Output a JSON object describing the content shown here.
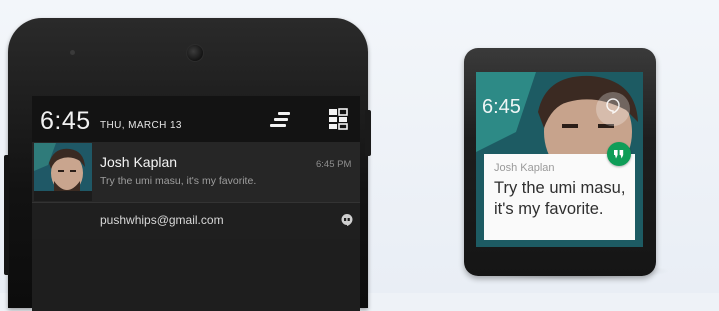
{
  "phone": {
    "status_bar": {
      "time": "6:45",
      "date": "THU, MARCH 13",
      "notifications_icon": "notification-shade-icon",
      "quick_settings_icon": "quick-settings-icon"
    },
    "notification": {
      "sender": "Josh Kaplan",
      "message": "Try the umi masu, it's my favorite.",
      "time": "6:45 PM",
      "account": "pushwhips@gmail.com",
      "app_icon": "hangouts-icon"
    }
  },
  "watch": {
    "time": "6:45",
    "card": {
      "sender": "Josh Kaplan",
      "message": "Try the umi masu, it's my favorite."
    },
    "app_icon": "hangouts-icon",
    "colors": {
      "badge": "#0f9d58",
      "card": "#fafafa"
    }
  }
}
